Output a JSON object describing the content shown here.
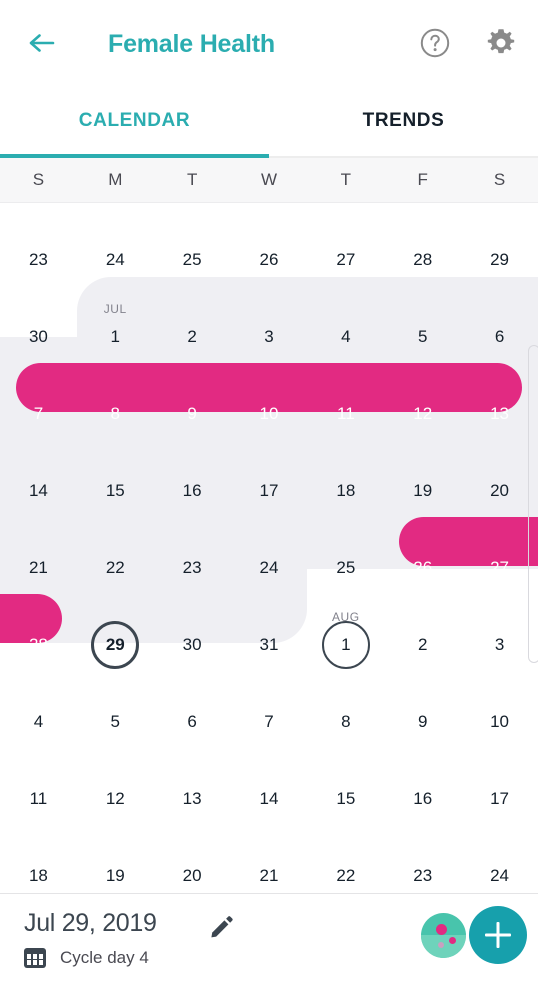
{
  "appbar": {
    "back_icon": "arrow-left-icon",
    "title": "Female Health",
    "help_icon": "help-circle-icon",
    "settings_icon": "gear-icon"
  },
  "tabs": {
    "calendar_label": "CALENDAR",
    "trends_label": "TRENDS",
    "active": "CALENDAR"
  },
  "weekdays": [
    "S",
    "M",
    "T",
    "W",
    "T",
    "F",
    "S"
  ],
  "calendar": {
    "month_labels": {
      "jul": "JUL",
      "aug": "AUG"
    },
    "weeks": [
      {
        "days": [
          "23",
          "24",
          "25",
          "26",
          "27",
          "28",
          "29"
        ]
      },
      {
        "days": [
          "30",
          "1",
          "2",
          "3",
          "4",
          "5",
          "6"
        ]
      },
      {
        "days": [
          "7",
          "8",
          "9",
          "10",
          "11",
          "12",
          "13"
        ]
      },
      {
        "days": [
          "14",
          "15",
          "16",
          "17",
          "18",
          "19",
          "20"
        ]
      },
      {
        "days": [
          "21",
          "22",
          "23",
          "24",
          "25",
          "26",
          "27"
        ]
      },
      {
        "days": [
          "28",
          "29",
          "30",
          "31",
          "1",
          "2",
          "3"
        ]
      },
      {
        "days": [
          "4",
          "5",
          "6",
          "7",
          "8",
          "9",
          "10"
        ]
      },
      {
        "days": [
          "11",
          "12",
          "13",
          "14",
          "15",
          "16",
          "17"
        ]
      },
      {
        "days": [
          "18",
          "19",
          "20",
          "21",
          "22",
          "23",
          "24"
        ]
      }
    ],
    "selected_day": "29",
    "today_day": "1"
  },
  "bottom": {
    "date": "Jul 29, 2019",
    "edit_icon": "pencil-icon",
    "cycle_icon": "calendar-icon",
    "cycle_text": "Cycle day 4",
    "symptoms_icon": "symptoms-icon",
    "add_icon": "plus-icon"
  },
  "colors": {
    "teal": "#2BADB0",
    "pink": "#E22A82",
    "month_shade": "#EFEFF3",
    "text_dark": "#15202B",
    "fab_teal": "#17A0AC"
  }
}
